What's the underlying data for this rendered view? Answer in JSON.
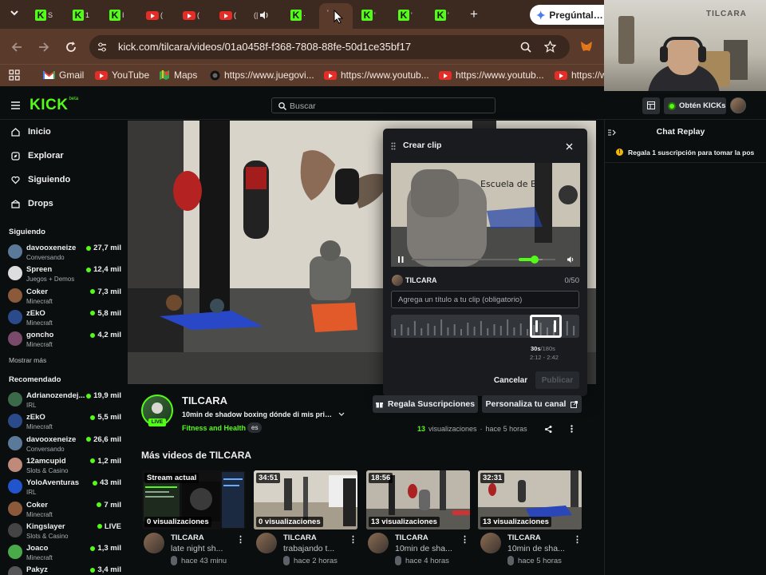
{
  "browser": {
    "tab_glyphs": {
      "kick": "K",
      "trunc_s": "S",
      "trunc_t": "1",
      "trunc_i": "I",
      "trunc_paren": "(",
      "trunc_dot": "·",
      "trunc_tick": "'",
      "audio_paren": "(|"
    },
    "new_tab": "+",
    "gemini_button": "Pregúntale a",
    "url": "kick.com/tilcara/videos/01a0458f-f368-7808-88fe-50d1ce35bf17",
    "bookmarks": [
      {
        "label": "Gmail",
        "icon": "gmail-icon"
      },
      {
        "label": "YouTube",
        "icon": "youtube-icon"
      },
      {
        "label": "Maps",
        "icon": "maps-icon"
      },
      {
        "label": "https://www.juegovi...",
        "icon": "site-icon"
      },
      {
        "label": "https://www.youtub...",
        "icon": "youtube-icon"
      },
      {
        "label": "https://www.youtub...",
        "icon": "youtube-icon"
      },
      {
        "label": "https://w",
        "icon": "youtube-icon"
      }
    ]
  },
  "webcam": {
    "sign": "TILCARA"
  },
  "kick": {
    "logo": "KICK",
    "logo_sup": "beta",
    "search_placeholder": "Buscar",
    "get_kicks": "Obtén KICKs"
  },
  "sidebar": {
    "nav": [
      {
        "label": "Inicio",
        "icon": "home-icon"
      },
      {
        "label": "Explorar",
        "icon": "compass-icon"
      },
      {
        "label": "Siguiendo",
        "icon": "heart-icon"
      },
      {
        "label": "Drops",
        "icon": "gift-icon"
      }
    ],
    "following_title": "Siguiendo",
    "following": [
      {
        "name": "davooxeneize",
        "cat": "Conversando",
        "viewers": "27,7 mil",
        "color": "#5b7a9a"
      },
      {
        "name": "Spreen",
        "cat": "Juegos + Demos",
        "viewers": "12,4 mil",
        "color": "#dddddd"
      },
      {
        "name": "Coker",
        "cat": "Minecraft",
        "viewers": "7,3 mil",
        "color": "#8a5a3a"
      },
      {
        "name": "zEkO",
        "cat": "Minecraft",
        "viewers": "5,8 mil",
        "color": "#2a4a8a"
      },
      {
        "name": "goncho",
        "cat": "Minecraft",
        "viewers": "4,2 mil",
        "color": "#7a4a6a"
      }
    ],
    "show_more": "Mostrar más",
    "recommended_title": "Recomendado",
    "recommended": [
      {
        "name": "Adrianozendej...",
        "cat": "IRL",
        "viewers": "19,9 mil",
        "color": "#3a6a4a"
      },
      {
        "name": "zEkO",
        "cat": "Minecraft",
        "viewers": "5,5 mil",
        "color": "#2a4a8a"
      },
      {
        "name": "davooxeneize",
        "cat": "Conversando",
        "viewers": "26,6 mil",
        "color": "#5b7a9a"
      },
      {
        "name": "12amcupid",
        "cat": "Slots & Casino",
        "viewers": "1,2 mil",
        "color": "#c08a7a"
      },
      {
        "name": "YoloAventuras",
        "cat": "IRL",
        "viewers": "43 mil",
        "color": "#2255cc"
      },
      {
        "name": "Coker",
        "cat": "Minecraft",
        "viewers": "7 mil",
        "color": "#8a5a3a"
      },
      {
        "name": "Kingslayer",
        "cat": "Slots & Casino",
        "viewers": "LIVE",
        "color": "#444444"
      },
      {
        "name": "Joaco",
        "cat": "Minecraft",
        "viewers": "1,3 mil",
        "color": "#4aaa4a"
      },
      {
        "name": "Pakyz",
        "cat": "",
        "viewers": "3,4 mil",
        "color": "#555555"
      }
    ]
  },
  "clip": {
    "title": "Crear clip",
    "channel": "TILCARA",
    "counter": "0/50",
    "placeholder": "Agrega un título a tu clip (obligatorio)",
    "duration": "30s",
    "duration_max": "/180s",
    "range": "2:12 - 2:42",
    "cancel": "Cancelar",
    "publish": "Publicar",
    "thumb_wall_text": "Escuela de BOX",
    "volume_level": 0.65
  },
  "chat": {
    "title": "Chat Replay",
    "notice": "Regala 1 suscripción para tomar la pos"
  },
  "channel": {
    "name": "TILCARA",
    "live_badge": "LIVE",
    "stream_title": "10min de shadow boxing dónde di mis prim...",
    "category": "Fitness and Health",
    "lang_tag": "es",
    "gift_subs": "Regala Suscripciones",
    "customize": "Personaliza tu canal",
    "views_count": "13",
    "views_label": "visualizaciones",
    "time_ago": "hace 5 horas"
  },
  "more_videos": {
    "title": "Más videos de TILCARA",
    "cards": [
      {
        "duration": "Stream actual",
        "views": "0 visualizaciones",
        "channel": "TILCARA",
        "title": "late night sh...",
        "meta": "hace 43 minu"
      },
      {
        "duration": "34:51",
        "views": "0 visualizaciones",
        "channel": "TILCARA",
        "title": "trabajando t...",
        "meta": "hace 2 horas"
      },
      {
        "duration": "18:56",
        "views": "13 visualizaciones",
        "channel": "TILCARA",
        "title": "10min de sha...",
        "meta": "hace 4 horas"
      },
      {
        "duration": "32:31",
        "views": "13 visualizaciones",
        "channel": "TILCARA",
        "title": "10min de sha...",
        "meta": "hace 5 horas"
      }
    ]
  },
  "video_wall_text": "ESCUELA DE BOX",
  "colors": {
    "accent": "#53fc18",
    "bg": "#0b0e0f",
    "panel": "#191b1f",
    "browser": "#5a3b2b"
  }
}
